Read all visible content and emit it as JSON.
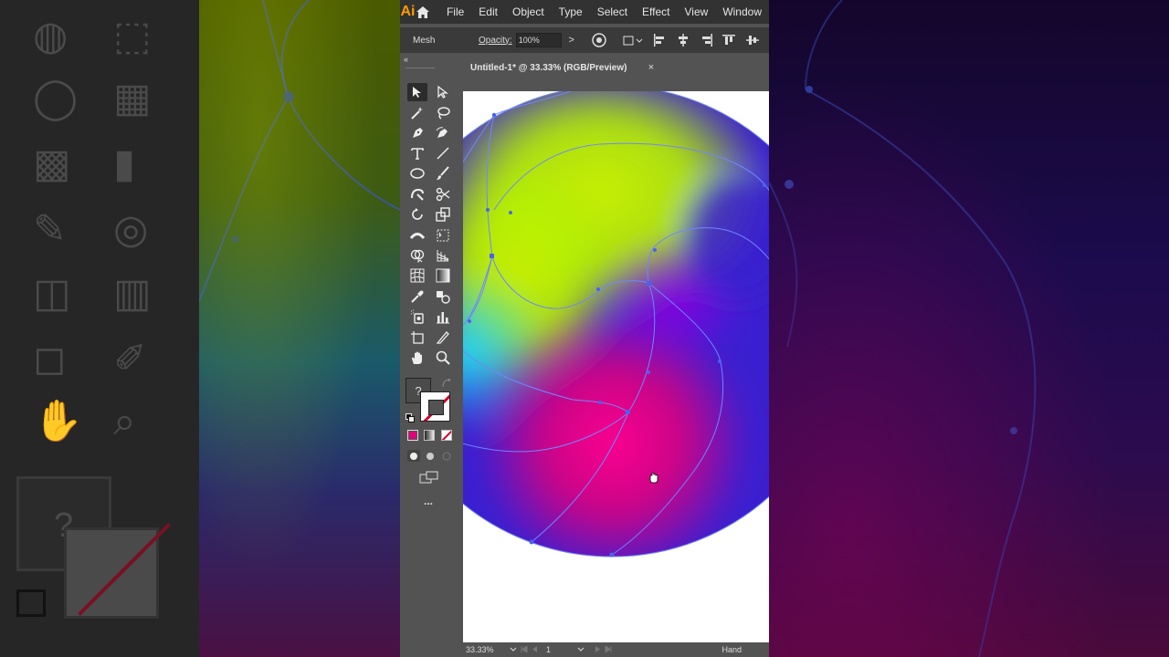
{
  "app": {
    "logo": "Ai",
    "menu": [
      "File",
      "Edit",
      "Object",
      "Type",
      "Select",
      "Effect",
      "View",
      "Window"
    ]
  },
  "control_bar": {
    "tool_name": "Mesh",
    "opacity_label": "Opacity:",
    "opacity_value": "100%",
    "chevron": ">"
  },
  "tools_panel": {
    "collapse_glyph": "«",
    "fill_unknown": "?",
    "more_tools": "..."
  },
  "document": {
    "tab_title": "Untitled-1* @ 33.33% (RGB/Preview)",
    "close_glyph": "×"
  },
  "status_bar": {
    "zoom": "33.33%",
    "page": "1",
    "tool": "Hand"
  },
  "colors": {
    "menubar_bg": "#323232",
    "panel_bg": "#535353",
    "logo_orange": "#ff9a00",
    "mesh_yellow": "#b7f200",
    "mesh_cyan": "#22d4f0",
    "mesh_magenta": "#e4007a",
    "mesh_indigo": "#3a1fd0",
    "mesh_path": "#6f86ff",
    "fill_swatch": "#e4007a"
  },
  "background_ghost": {
    "unknown_glyph": "?"
  }
}
